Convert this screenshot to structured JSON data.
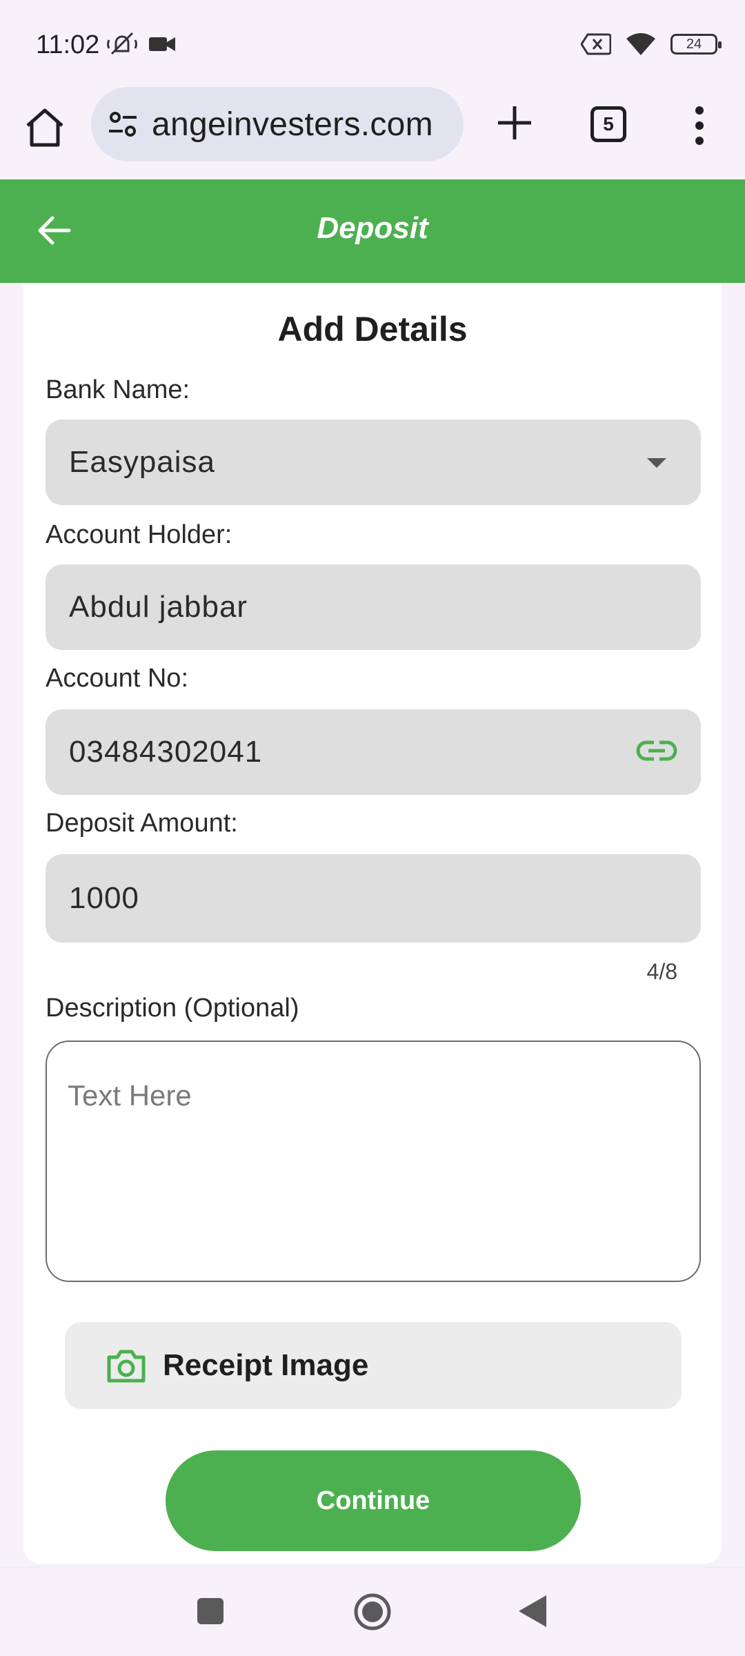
{
  "status_bar": {
    "time": "11:02",
    "battery": "24",
    "icons": [
      "mute-icon",
      "video-icon",
      "no-sim-icon",
      "wifi-icon",
      "battery-icon"
    ]
  },
  "browser": {
    "url": "angeinvesters.com",
    "tab_count": "5",
    "icons": [
      "home-icon",
      "site-settings-icon",
      "new-tab-icon",
      "menu-icon"
    ]
  },
  "header": {
    "title": "Deposit",
    "accent_color": "#4cb050"
  },
  "form": {
    "title": "Add Details",
    "bank_label": "Bank Name:",
    "bank_value": "Easypaisa",
    "holder_label": "Account Holder:",
    "holder_value": "Abdul jabbar",
    "account_label": "Account No:",
    "account_value": "03484302041",
    "amount_label": "Deposit Amount:",
    "amount_value": "1000",
    "amount_counter": "4/8",
    "description_label": "Description (Optional)",
    "description_placeholder": "Text Here",
    "receipt_label": "Receipt Image",
    "continue_label": "Continue"
  }
}
